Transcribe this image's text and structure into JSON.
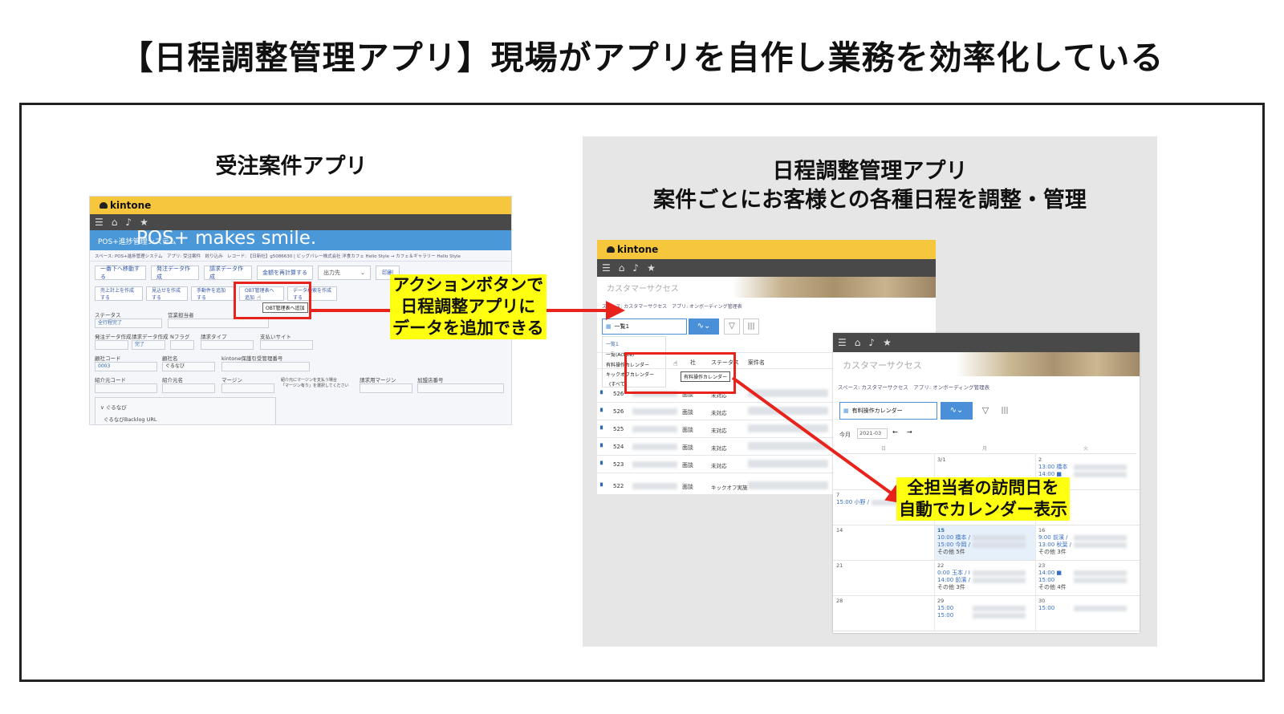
{
  "slide": {
    "title": "【日程調整管理アプリ】現場がアプリを自作し業務を効率化している"
  },
  "left_section": {
    "title": "受注案件アプリ",
    "kintone_label": "kintone",
    "banner_small": "POS+進捗管理システム",
    "banner_large": "POS+ makes smile.",
    "breadcrumb": "スペース: POS+進捗管理システム　アプリ: 受注案件　絞り込み　レコード: 【日新社】g5086630 | ビッグバレー株式会社 洋食カフェ Hello Style → カフェ＆ギャラリー Hello Style",
    "buttons_row1": [
      "一番下へ移動する",
      "発注データ作成",
      "請求データ作成",
      "金額を再計算する",
      "出力先",
      "印刷"
    ],
    "buttons_row2": [
      "売上計上を作成する",
      "見込せを作成する",
      "手動件を追加する",
      "OBT管理表へ追加",
      "データ検索を作成する"
    ],
    "tooltip": "OBT管理表へ追加",
    "fields": {
      "status_label": "ステータス",
      "status_value": "全行程完了",
      "sales_rep_label": "営業担当者",
      "order_data_label": "発注データ作成",
      "billing_data_label": "請求データ作成",
      "billing_data_value": "完了",
      "n_flag_label": "Nフラグ",
      "billing_type_label": "請求タイプ",
      "payment_site_label": "支払いサイト",
      "company_code_label": "顧社コード",
      "company_code_value": "0003",
      "company_name_label": "顧社名",
      "company_name_value": "ぐるなび",
      "kintone_id_label": "kintone保護引受管理番号",
      "referrer_code_label": "紹介元コード",
      "referrer_name_label": "紹介元名",
      "margin_label": "マージン",
      "margin_note": "紹介元にマージンを支払う場合\n「マージン有り」を選択してください",
      "billing_margin_label": "請求用マージン",
      "additional_label": "加盟店番号",
      "group_label": "∨ ぐるなび",
      "backlog_label": "ぐるなびBacklog URL"
    }
  },
  "right_section": {
    "title_line1": "日程調整管理アプリ",
    "title_line2": "案件ごとにお客様との各種日程を調整・管理",
    "kintone_label": "kintone",
    "space_name": "カスタマーサクセス",
    "breadcrumb": "スペース: カスタマーサクセス　アプリ: オンボーディング管理表",
    "view_selected": "一覧1",
    "view_options": [
      "一覧1",
      "一覧(Active)",
      "有料操作カレンダー",
      "キックオフカレンダー",
      "(すべて)"
    ],
    "view_tooltip": "有料操作カレンダー",
    "table_headers": [
      "社",
      "ステータス",
      "案件名"
    ],
    "rows": [
      {
        "id": "526",
        "type": "面談",
        "status": "未対応"
      },
      {
        "id": "526",
        "type": "面談",
        "status": "未対応"
      },
      {
        "id": "525",
        "type": "面談",
        "status": "未対応"
      },
      {
        "id": "524",
        "type": "面談",
        "status": "未対応"
      },
      {
        "id": "523",
        "type": "面談",
        "status": "未対応"
      },
      {
        "id": "522",
        "type": "面談",
        "status": "キックオフ実施"
      }
    ],
    "calendar": {
      "space_name": "カスタマーサクセス",
      "breadcrumb": "スペース: カスタマーサクセス　アプリ: オンボーディング管理表",
      "view_selected": "有料操作カレンダー",
      "today_label": "今月",
      "month_value": "2021-03",
      "weekday_headers": [
        "日",
        "月",
        "火"
      ],
      "weeks": [
        {
          "sun": "",
          "mon": "3/1",
          "tue": "2",
          "tue_items": [
            "13:00 橋本",
            "14:00 ■"
          ]
        },
        {
          "sun": "7",
          "sun_items": [
            "15:00 小野 /"
          ],
          "mon": "",
          "tue": ""
        },
        {
          "sun": "14",
          "mon": "15",
          "mon_items": [
            "10:00 橋本 /",
            "15:00 今岡 /",
            "その他 5件"
          ],
          "tue": "16",
          "tue_items": [
            "9:00 前濱 /",
            "13:00 秋葉 /",
            "その他 3件"
          ]
        },
        {
          "sun": "21",
          "mon": "22",
          "mon_items": [
            "0:00 玉本 / I",
            "14:00 前濱 /",
            "その他 3件"
          ],
          "tue": "23",
          "tue_items": [
            "14:00 ■",
            "15:00",
            "その他 4件"
          ]
        },
        {
          "sun": "28",
          "mon": "29",
          "mon_items": [
            "15:00",
            "15:00"
          ],
          "tue": "30",
          "tue_items": [
            "15:00"
          ]
        }
      ]
    }
  },
  "callouts": {
    "action_button": "アクションボタンで\n日程調整アプリに\nデータを追加できる",
    "calendar_display": "全担当者の訪問日を\n自動でカレンダー表示"
  },
  "colors": {
    "kintone_yellow": "#f6c73d",
    "banner_blue": "#4b98d9",
    "highlight_red": "#e8231c",
    "callout_yellow": "#ffff10",
    "panel_gray": "#e6e6e6"
  }
}
